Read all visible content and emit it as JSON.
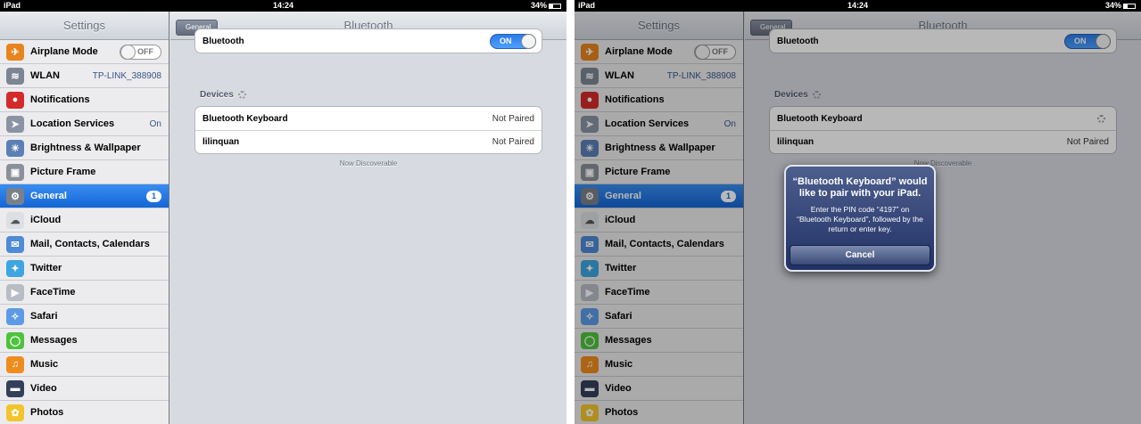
{
  "status": {
    "carrier": "iPad",
    "time": "14:24",
    "battery": "34%"
  },
  "sidebar": {
    "title": "Settings",
    "items": [
      {
        "name": "airplane-mode",
        "icon": "airplane-icon",
        "label": "Airplane Mode",
        "toggle": "OFF",
        "color": "#e8841e"
      },
      {
        "name": "wlan",
        "icon": "wifi-icon",
        "label": "WLAN",
        "value": "TP-LINK_388908",
        "color": "#7c8594"
      },
      {
        "name": "notifications",
        "icon": "notifications-icon",
        "label": "Notifications",
        "color": "#d42a2a"
      },
      {
        "name": "location-services",
        "icon": "location-icon",
        "label": "Location Services",
        "value": "On",
        "color": "#8a93a3"
      },
      {
        "name": "brightness-wallpaper",
        "icon": "brightness-icon",
        "label": "Brightness & Wallpaper",
        "color": "#5b7fb6"
      },
      {
        "name": "picture-frame",
        "icon": "picture-frame-icon",
        "label": "Picture Frame",
        "color": "#8a8f98"
      },
      {
        "name": "general",
        "icon": "gear-icon",
        "label": "General",
        "badge": "1",
        "color": "#7a808a",
        "selected": true
      },
      {
        "name": "icloud",
        "icon": "cloud-icon",
        "label": "iCloud",
        "color": "#dcdfe4"
      },
      {
        "name": "mail",
        "icon": "mail-icon",
        "label": "Mail, Contacts, Calendars",
        "color": "#4e8ad6"
      },
      {
        "name": "twitter",
        "icon": "twitter-icon",
        "label": "Twitter",
        "color": "#3ea5e0"
      },
      {
        "name": "facetime",
        "icon": "facetime-icon",
        "label": "FaceTime",
        "color": "#b8bcc4"
      },
      {
        "name": "safari",
        "icon": "safari-icon",
        "label": "Safari",
        "color": "#5c9ae6"
      },
      {
        "name": "messages",
        "icon": "messages-icon",
        "label": "Messages",
        "color": "#4fc23d"
      },
      {
        "name": "music",
        "icon": "music-icon",
        "label": "Music",
        "color": "#ef8c1e"
      },
      {
        "name": "video",
        "icon": "video-icon",
        "label": "Video",
        "color": "#34405a"
      },
      {
        "name": "photos",
        "icon": "photos-icon",
        "label": "Photos",
        "color": "#f3c52b"
      }
    ]
  },
  "detail": {
    "back_label": "General",
    "title": "Bluetooth",
    "bluetooth_label": "Bluetooth",
    "bluetooth_toggle": "ON",
    "devices_header": "Devices",
    "devices": [
      {
        "name": "Bluetooth Keyboard",
        "status": "Not Paired"
      },
      {
        "name": "lilinquan",
        "status": "Not Paired"
      }
    ],
    "discoverable": "Now Discoverable"
  },
  "alert": {
    "title": "“Bluetooth Keyboard” would like to pair with your iPad.",
    "message": "Enter the PIN code “4197” on “Bluetooth Keyboard”, followed by the return or enter key.",
    "cancel": "Cancel"
  }
}
